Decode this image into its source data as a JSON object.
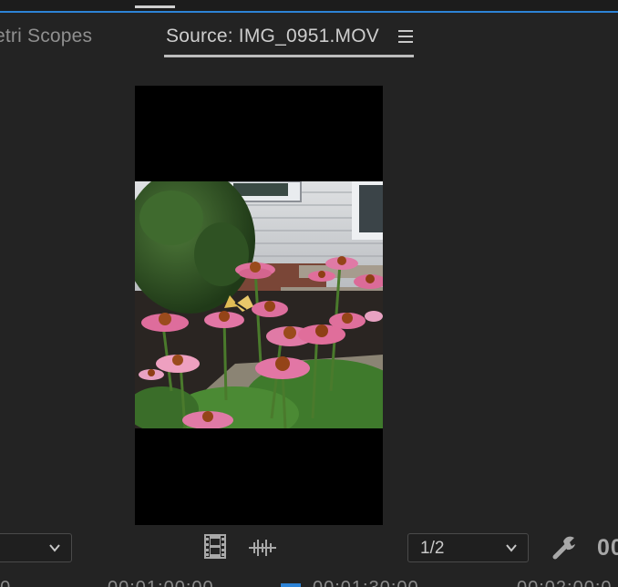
{
  "tabs": {
    "lumetri_scopes": "etri Scopes",
    "source": "Source: IMG_0951.MOV"
  },
  "controls": {
    "left_dropdown_value": "",
    "playback_resolution": "1/2",
    "timecode_partial": "00"
  },
  "ruler": {
    "labels": [
      "00",
      "00:01:00:00",
      "00:01:30:00",
      "00:02:00:0"
    ]
  },
  "colors": {
    "accent": "#2d83d6",
    "panel_bg": "#232323",
    "video_bg": "#000000"
  },
  "icons": {
    "panel_menu": "hamburger-icon",
    "film": "film-strip-icon",
    "audio": "audio-waveform-icon",
    "settings": "wrench-icon",
    "dropdown": "chevron-down-icon"
  }
}
